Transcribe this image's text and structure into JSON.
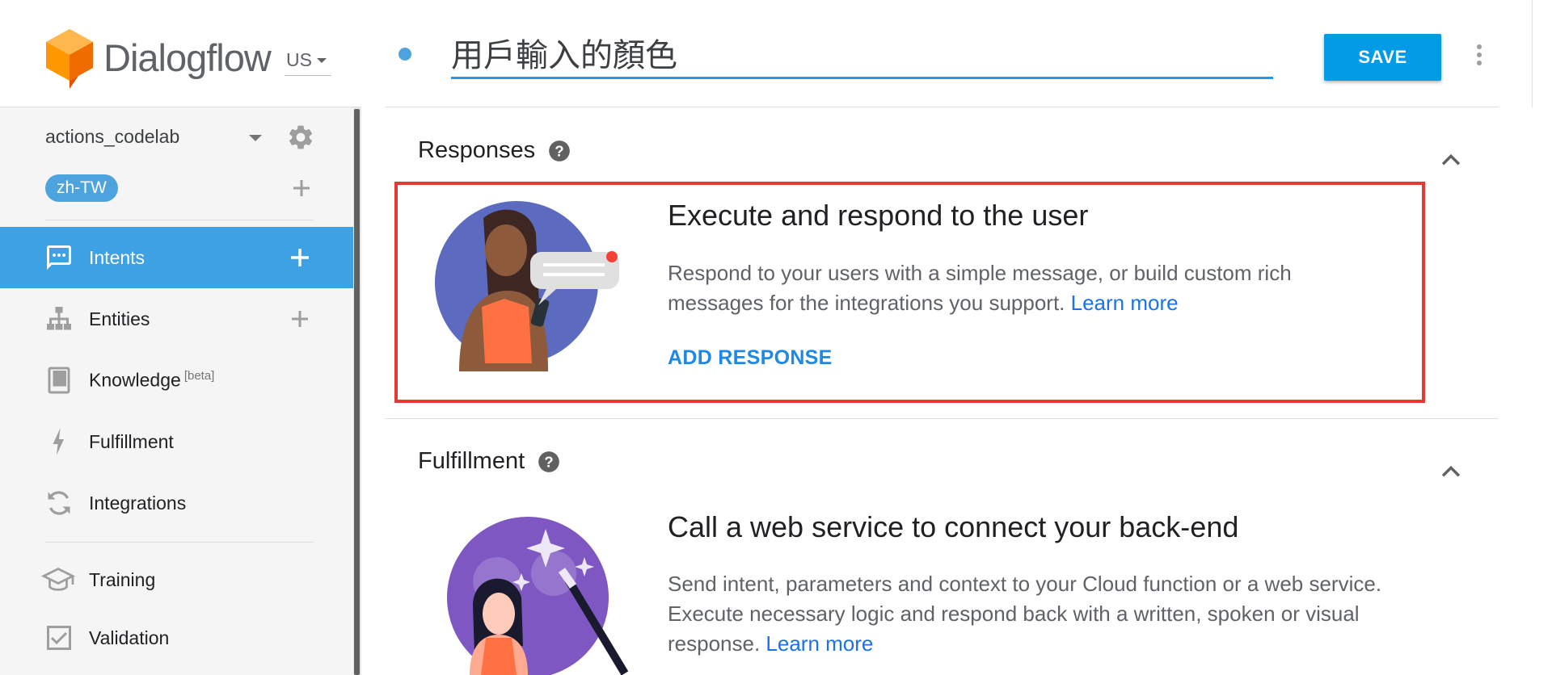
{
  "app": {
    "logo_text": "Dialogflow",
    "region": "US"
  },
  "agent": {
    "name": "actions_codelab",
    "language": "zh-TW"
  },
  "nav": {
    "items": [
      {
        "label": "Intents",
        "icon": "chat-bubble-icon",
        "active": true,
        "has_add": true
      },
      {
        "label": "Entities",
        "icon": "hierarchy-icon",
        "active": false,
        "has_add": true
      },
      {
        "label": "Knowledge",
        "badge": "[beta]",
        "icon": "book-icon",
        "active": false,
        "has_add": false
      },
      {
        "label": "Fulfillment",
        "icon": "lightning-icon",
        "active": false,
        "has_add": false
      },
      {
        "label": "Integrations",
        "icon": "sync-icon",
        "active": false,
        "has_add": false
      },
      {
        "label": "Training",
        "icon": "graduation-cap-icon",
        "active": false,
        "has_add": false
      },
      {
        "label": "Validation",
        "icon": "checkbox-icon",
        "active": false,
        "has_add": false
      }
    ]
  },
  "intent": {
    "name": "用戶輸入的顏色",
    "save_label": "SAVE"
  },
  "responses": {
    "title": "Responses",
    "heading": "Execute and respond to the user",
    "desc_line1": "Respond to your users with a simple message, or build custom rich",
    "desc_line2": "messages for the integrations you support.",
    "learn_more": "Learn more",
    "add_label": "ADD RESPONSE"
  },
  "fulfillment": {
    "title": "Fulfillment",
    "heading": "Call a web service to connect your back-end",
    "desc_line1": "Send intent, parameters and context to your Cloud function or a web service.",
    "desc_line2": "Execute necessary logic and respond back with a written, spoken or visual",
    "desc_line3": "response.",
    "learn_more": "Learn more"
  },
  "colors": {
    "accent": "#3ea1e3",
    "save": "#039be5",
    "highlight": "#e53935",
    "link": "#1a73e8"
  }
}
